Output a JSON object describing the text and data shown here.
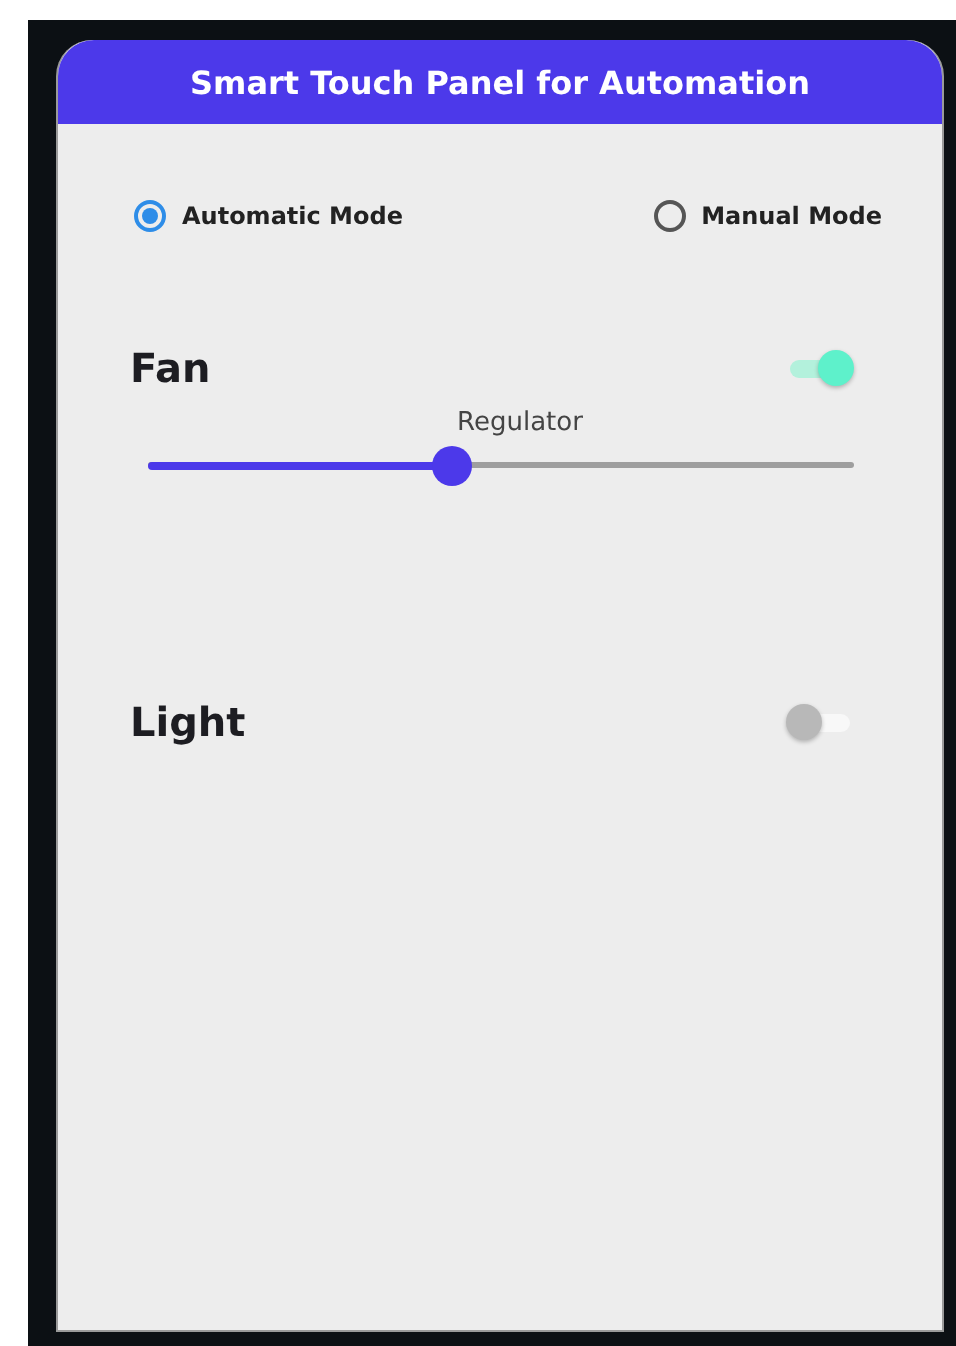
{
  "header": {
    "title": "Smart Touch Panel for Automation"
  },
  "modes": [
    {
      "label": "Automatic Mode",
      "selected": true
    },
    {
      "label": "Manual Mode",
      "selected": false
    }
  ],
  "devices": [
    {
      "kind": "slider",
      "name": "Fan",
      "on": true,
      "regulator": {
        "label": "Regulator",
        "level": 0.43
      }
    },
    {
      "kind": "plain",
      "name": "Light",
      "on": false
    }
  ]
}
